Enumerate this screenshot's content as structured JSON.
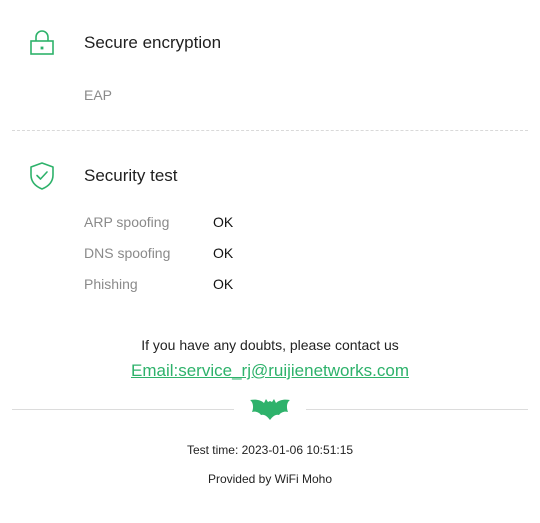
{
  "encryption": {
    "title": "Secure encryption",
    "icon": "lock-icon",
    "value": "EAP"
  },
  "security_test": {
    "title": "Security test",
    "icon": "shield-check-icon",
    "items": [
      {
        "label": "ARP spoofing",
        "result": "OK"
      },
      {
        "label": "DNS spoofing",
        "result": "OK"
      },
      {
        "label": "Phishing",
        "result": "OK"
      }
    ]
  },
  "contact": {
    "text": "If you have any doubts, please contact us",
    "email_link": "Email:service_rj@ruijienetworks.com"
  },
  "footer": {
    "logo_icon": "bat-logo-icon",
    "test_time": "Test time: 2023-01-06 10:51:15",
    "provided_by": "Provided by WiFi Moho"
  },
  "colors": {
    "accent_green": "#2eb26b",
    "label_gray": "#8a8a8a",
    "divider": "#dcdcdc"
  }
}
